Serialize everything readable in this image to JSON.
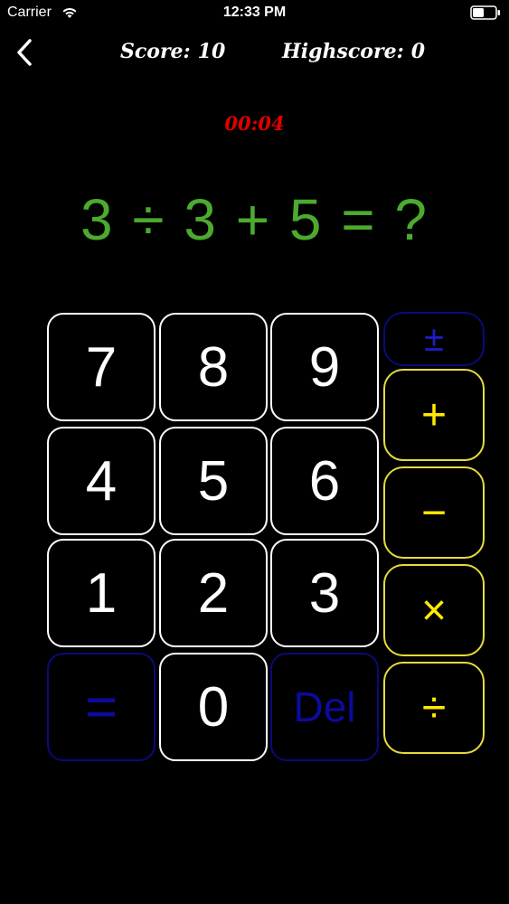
{
  "status_bar": {
    "carrier": "Carrier",
    "time": "12:33 PM",
    "icons": [
      "wifi-icon",
      "battery-icon"
    ]
  },
  "header": {
    "back_icon": "chevron-left-icon",
    "score_label": "Score:",
    "score_value": "10",
    "highscore_label": "Highscore:",
    "highscore_value": "0"
  },
  "timer": "00:04",
  "equation": "3 ÷ 3 + 5 = ?",
  "keypad": {
    "digits": {
      "k7": "7",
      "k8": "8",
      "k9": "9",
      "k4": "4",
      "k5": "5",
      "k6": "6",
      "k1": "1",
      "k2": "2",
      "k3": "3",
      "k0": "0"
    },
    "equals": "=",
    "delete": "Del",
    "operators": {
      "plus_minus": "±",
      "plus": "+",
      "minus": "−",
      "multiply": "×",
      "divide": "÷"
    }
  },
  "colors": {
    "background": "#000000",
    "equation": "#4caa2e",
    "timer": "#e00000",
    "operator": "#ffea00",
    "operator_border": "#e6dc3c",
    "disabled": "#0a0a7a"
  }
}
